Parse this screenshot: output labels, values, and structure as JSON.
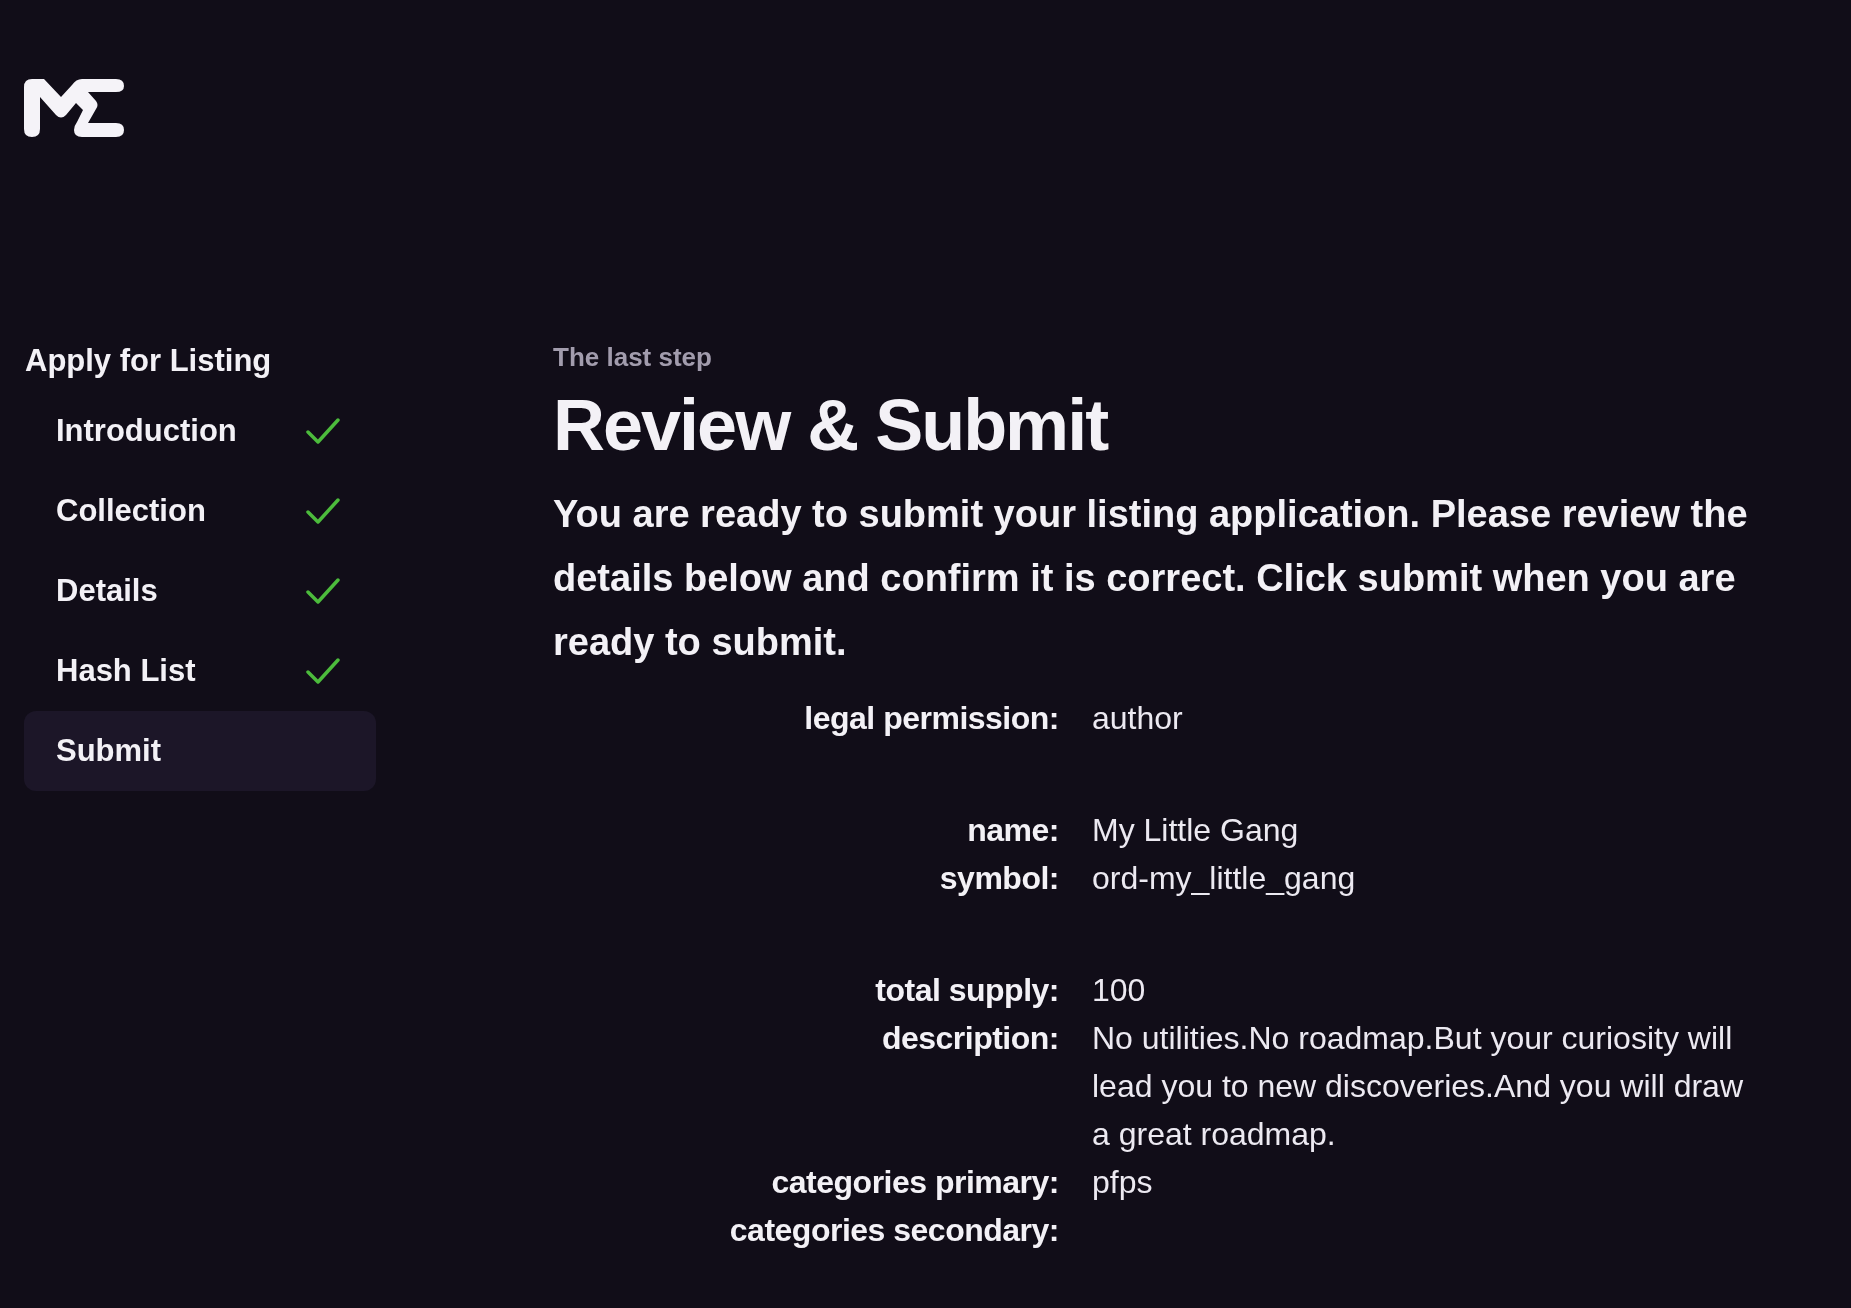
{
  "sidebar": {
    "title": "Apply for Listing",
    "steps": [
      {
        "label": "Introduction",
        "done": true,
        "selected": false
      },
      {
        "label": "Collection",
        "done": true,
        "selected": false
      },
      {
        "label": "Details",
        "done": true,
        "selected": false
      },
      {
        "label": "Hash List",
        "done": true,
        "selected": false
      },
      {
        "label": "Submit",
        "done": false,
        "selected": true
      }
    ]
  },
  "main": {
    "eyebrow": "The last step",
    "title": "Review & Submit",
    "intro": "You are ready to submit your listing application. Please review the details below and confirm it is correct. Click submit when you are ready to submit.",
    "details": [
      {
        "rows": [
          {
            "label": "legal permission:",
            "value": "author"
          }
        ]
      },
      {
        "rows": [
          {
            "label": "name:",
            "value": "My Little Gang"
          },
          {
            "label": "symbol:",
            "value": "ord-my_little_gang"
          }
        ]
      },
      {
        "rows": [
          {
            "label": "total supply:",
            "value": "100"
          },
          {
            "label": "description:",
            "value": "No utilities.No roadmap.But your curiosity will lead you to new discoveries.And you will draw a great roadmap."
          },
          {
            "label": "categories primary:",
            "value": "pfps"
          },
          {
            "label": "categories secondary:"
          }
        ]
      }
    ]
  }
}
